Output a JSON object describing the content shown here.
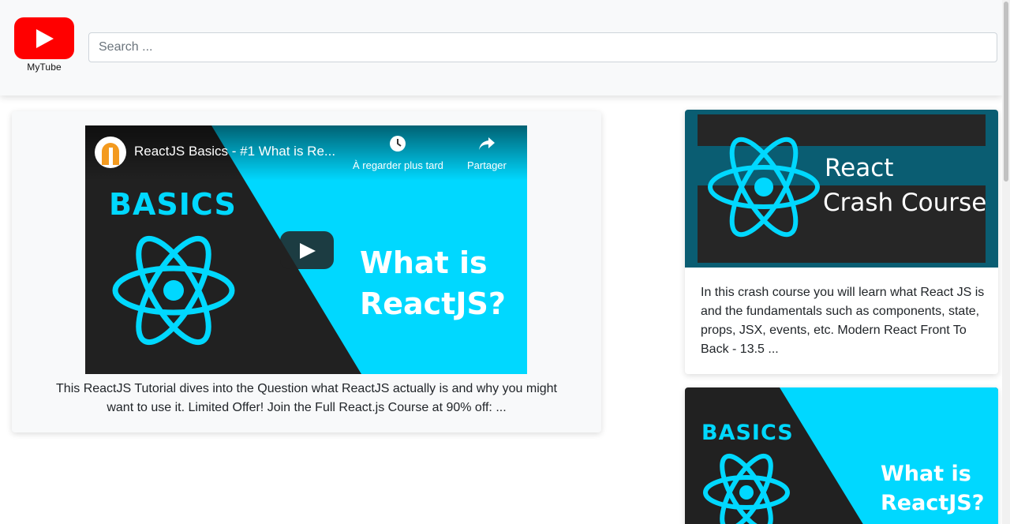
{
  "header": {
    "logo_text": "MyTube",
    "search_placeholder": "Search ..."
  },
  "player": {
    "title": "ReactJS Basics - #1 What is Re...",
    "watch_later_label": "À regarder plus tard",
    "share_label": "Partager",
    "thumb_heading": "BASICS",
    "thumb_question_line1": "What is",
    "thumb_question_line2": "ReactJS?"
  },
  "selected_video": {
    "description": "This ReactJS Tutorial dives into the Question what ReactJS actually is and why you might want to use it. Limited Offer! Join the Full React.js Course at 90% off: ..."
  },
  "sidebar": {
    "videos": [
      {
        "thumb_line1": "React",
        "thumb_line2": "Crash Course",
        "description": "In this crash course you will learn what React JS is and the fundamentals such as components, state, props, JSX, events, etc. Modern React Front To Back - 13.5 ..."
      },
      {
        "thumb_heading": "BASICS",
        "thumb_line1": "What is",
        "thumb_line2": "ReactJS?"
      }
    ]
  },
  "colors": {
    "brand_red": "#ff0000",
    "react_cyan": "#00d8ff",
    "thumb_dark": "#212121",
    "crash_bg": "#0a5d72"
  }
}
